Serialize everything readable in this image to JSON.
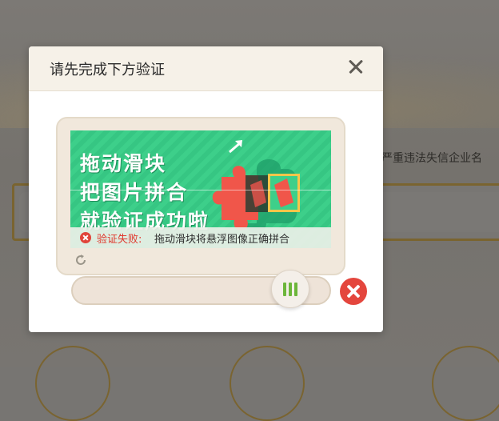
{
  "background": {
    "text_right": "严重违法失信企业名"
  },
  "modal": {
    "title": "请先完成下方验证",
    "close_icon": "close-icon"
  },
  "captcha": {
    "image_lines": [
      "拖动滑块",
      "把图片拼合",
      "就验证成功啦"
    ],
    "status_label": "验证失败:",
    "status_message": "拖动滑块将悬浮图像正确拼合",
    "refresh_icon": "refresh-icon"
  },
  "slider": {
    "handle_icon": "grip-icon",
    "result_icon": "fail-icon"
  },
  "colors": {
    "captcha_green": "#3dcf8a",
    "puzzle_red": "#f0564a",
    "fail_red": "#e4463d",
    "grip_green": "#6cb63a"
  }
}
